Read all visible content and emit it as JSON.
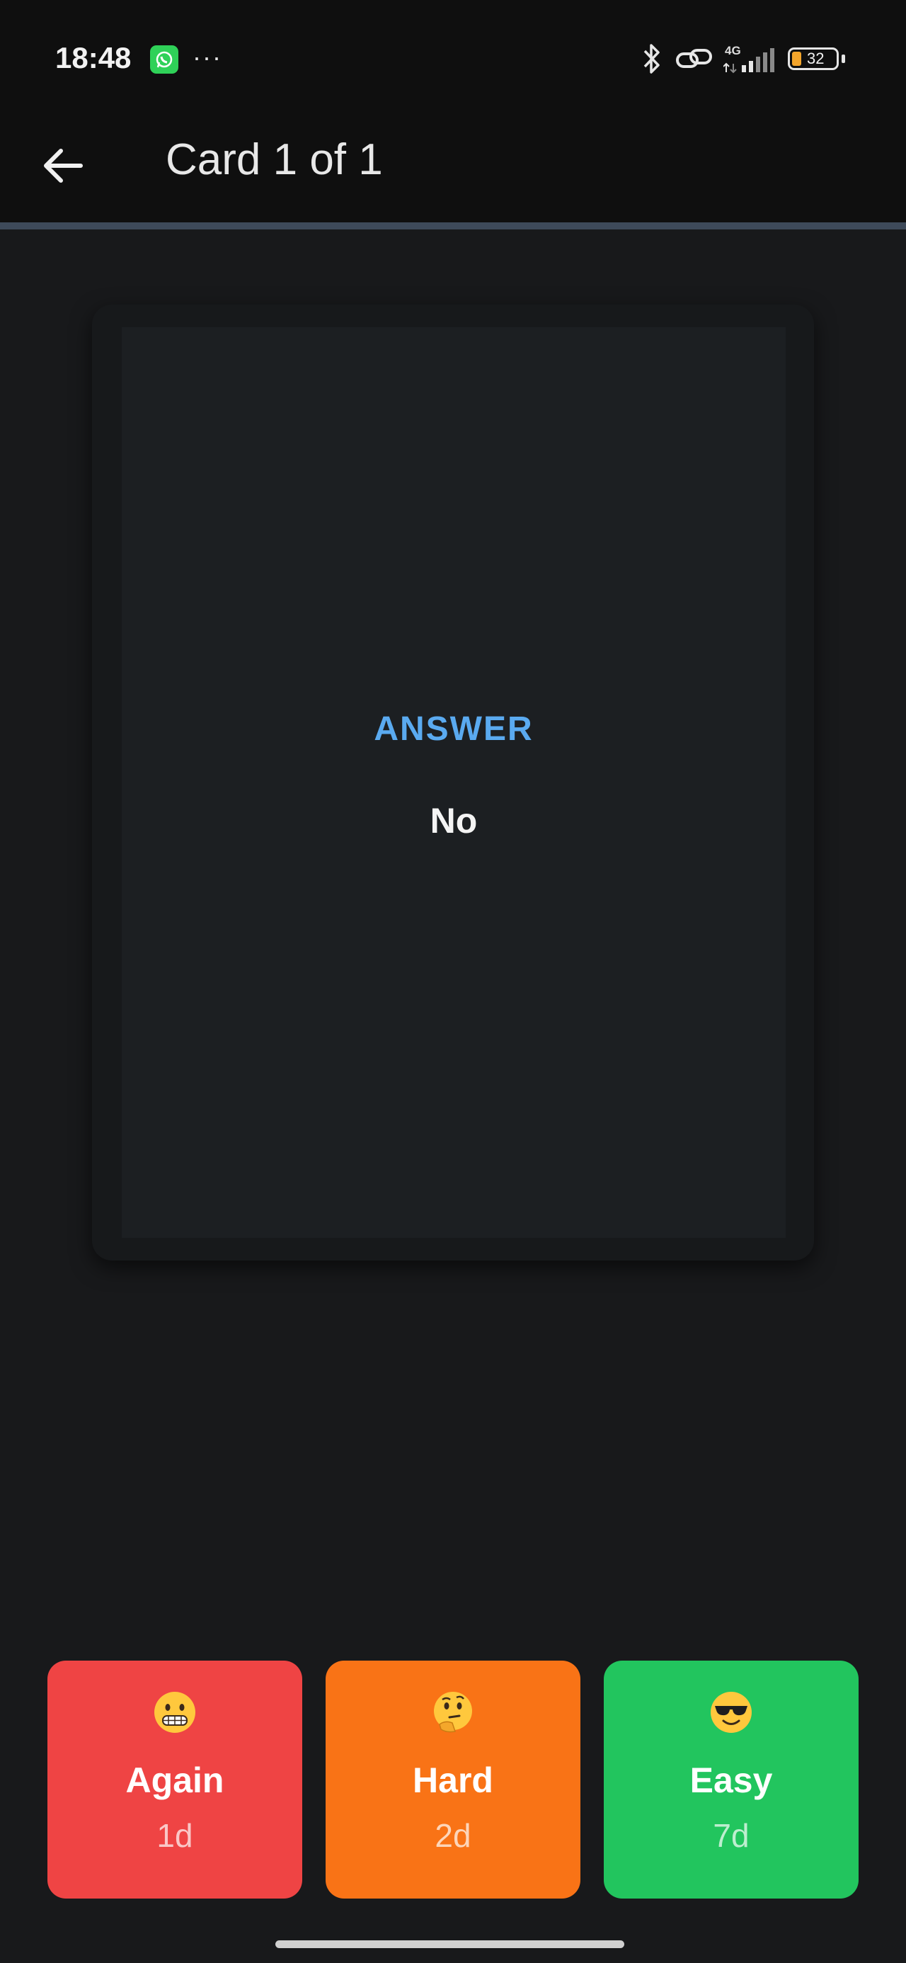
{
  "status_bar": {
    "time": "18:48",
    "dots": "···",
    "network": "4G",
    "battery": "32",
    "icons": [
      "whatsapp-icon",
      "bluetooth-icon",
      "link-icon",
      "signal-icon",
      "battery-icon"
    ]
  },
  "header": {
    "title": "Card 1 of 1",
    "back_icon": "arrow-left-icon"
  },
  "card": {
    "label": "ANSWER",
    "text": "No"
  },
  "ratings": [
    {
      "label": "Again",
      "interval": "1d",
      "emoji": "grimacing-face",
      "color": "#ef4444"
    },
    {
      "label": "Hard",
      "interval": "2d",
      "emoji": "thinking-face",
      "color": "#f97316"
    },
    {
      "label": "Easy",
      "interval": "7d",
      "emoji": "sunglasses-face",
      "color": "#22c55e"
    }
  ],
  "colors": {
    "accent": "#5aaaf0",
    "background": "#18191b",
    "card": "#1c1f22"
  }
}
